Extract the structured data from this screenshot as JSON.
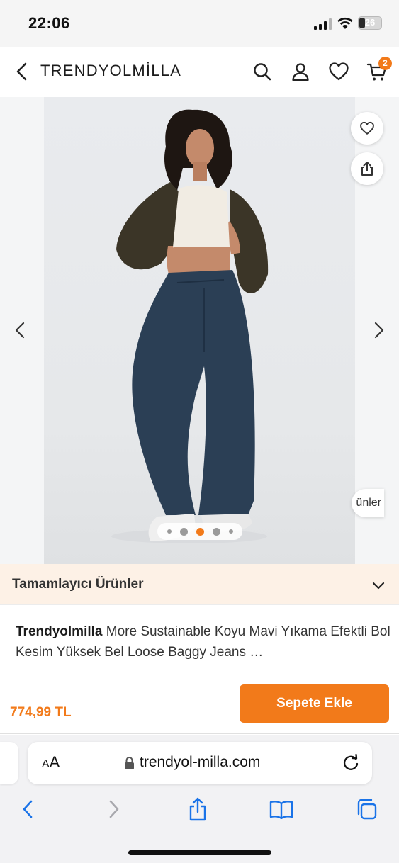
{
  "status_bar": {
    "time": "22:06",
    "battery": "26",
    "battery_level": 0.26
  },
  "header": {
    "brand": "TRENDYOLMİLLA",
    "cart_count": "2"
  },
  "gallery": {
    "slide_count": 5,
    "active_slide": 3,
    "similar_label": "ünler"
  },
  "complementary": {
    "label": "Tamamlayıcı Ürünler"
  },
  "product": {
    "brand": "Trendyolmilla",
    "name": " More Sustainable Koyu Mavi Yıkama Efektli Bol Kesim Yüksek Bel Loose Baggy Jeans …"
  },
  "buy_bar": {
    "price": "774,99 TL",
    "add_to_cart": "Sepete Ekle"
  },
  "safari": {
    "aa": "AA",
    "url": "trendyol-milla.com"
  },
  "colors": {
    "accent": "#f27a1a",
    "complementary_bg": "#fdf1e6",
    "denim": "#2b3f55",
    "jacket": "#3b3527"
  }
}
